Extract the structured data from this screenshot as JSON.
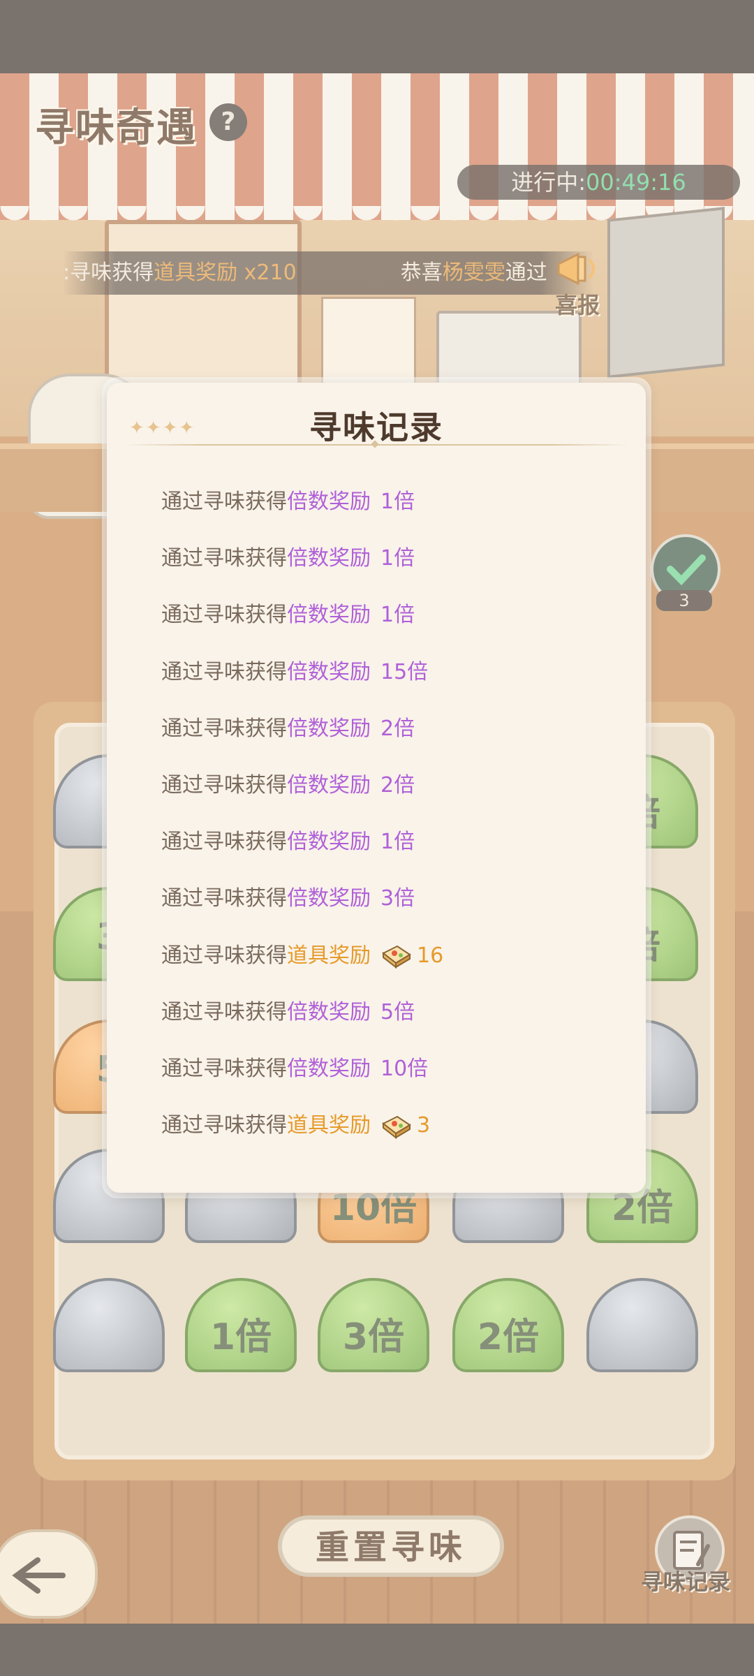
{
  "header": {
    "title": "寻味奇遇",
    "help_icon": "?",
    "timer_label": "进行中:",
    "timer_value": "00:49:16"
  },
  "ticker": {
    "part1_prefix": ":寻味获得",
    "part1_highlight": "道具奖励 x210",
    "part2_prefix": "恭喜",
    "part2_name": "杨雯雯",
    "part2_suffix": "通过"
  },
  "news": {
    "label": "喜报",
    "icon": "megaphone-icon"
  },
  "check_badge": {
    "count": "3",
    "icon": "check-icon"
  },
  "board": {
    "row1": [
      "",
      "",
      "",
      "",
      "倍"
    ],
    "row2": [
      "3",
      "",
      "",
      "",
      "倍"
    ],
    "row3": [
      "5",
      "",
      "",
      "",
      ""
    ],
    "row4": [
      "",
      "",
      "10倍",
      "",
      "2倍"
    ],
    "row5": [
      "",
      "1倍",
      "3倍",
      "2倍",
      ""
    ]
  },
  "modal": {
    "title": "寻味记录",
    "stars": "✦✦✦✦",
    "records": [
      {
        "prefix": "通过寻味获得",
        "type": "倍数奖励",
        "value": "1倍",
        "kind": "multiplier"
      },
      {
        "prefix": "通过寻味获得",
        "type": "倍数奖励",
        "value": "1倍",
        "kind": "multiplier"
      },
      {
        "prefix": "通过寻味获得",
        "type": "倍数奖励",
        "value": "1倍",
        "kind": "multiplier"
      },
      {
        "prefix": "通过寻味获得",
        "type": "倍数奖励",
        "value": "15倍",
        "kind": "multiplier"
      },
      {
        "prefix": "通过寻味获得",
        "type": "倍数奖励",
        "value": "2倍",
        "kind": "multiplier"
      },
      {
        "prefix": "通过寻味获得",
        "type": "倍数奖励",
        "value": "2倍",
        "kind": "multiplier"
      },
      {
        "prefix": "通过寻味获得",
        "type": "倍数奖励",
        "value": "1倍",
        "kind": "multiplier"
      },
      {
        "prefix": "通过寻味获得",
        "type": "倍数奖励",
        "value": "3倍",
        "kind": "multiplier"
      },
      {
        "prefix": "通过寻味获得",
        "type": "道具奖励",
        "value": "16",
        "kind": "item"
      },
      {
        "prefix": "通过寻味获得",
        "type": "倍数奖励",
        "value": "5倍",
        "kind": "multiplier"
      },
      {
        "prefix": "通过寻味获得",
        "type": "倍数奖励",
        "value": "10倍",
        "kind": "multiplier"
      },
      {
        "prefix": "通过寻味获得",
        "type": "道具奖励",
        "value": "3",
        "kind": "item"
      }
    ]
  },
  "controls": {
    "reset_label": "重置寻味",
    "record_label": "寻味记录",
    "back_icon": "back-arrow-icon"
  }
}
